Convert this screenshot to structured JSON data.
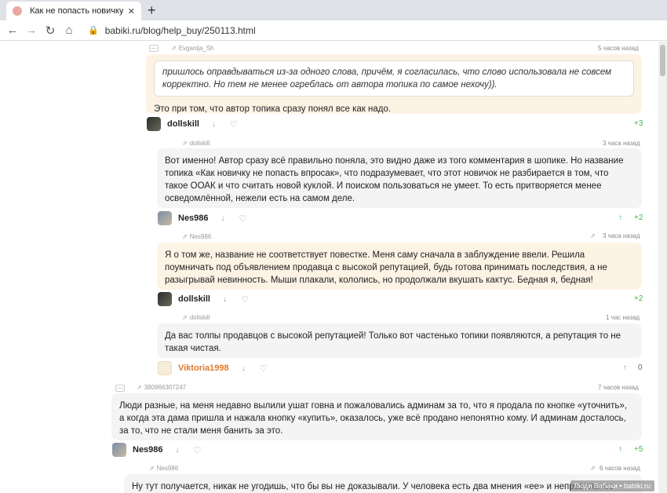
{
  "browser": {
    "tab_title": "Как не попасть новичку впроса",
    "tab_close": "✕",
    "new_tab": "+",
    "url": "babiki.ru/blog/help_buy/250113.html"
  },
  "comments": {
    "c1": {
      "reply_to": "Evganija_Sh",
      "time": "5 часов назад",
      "quote": "пришлось оправдываться из-за одного слова, причём, я согласилась, что слово использовала не совсем корректно. Но тем не менее огреблась от автора топика по самое нехочу)).",
      "text": "Это при том, что автор топика сразу понял все как надо."
    },
    "u1": {
      "name": "dollskill",
      "score": "+3"
    },
    "c2": {
      "reply_to": "dollskill",
      "time": "3 часа назад",
      "text": "Вот именно! Автор сразу всё правильно поняла, это видно даже из того комментария в шопике. Но название топика «Как новичку не попасть впросак», что подразумевает, что этот новичок не разбирается в том, что такое ООАК и что считать новой куклой. И поиском пользоваться не умеет. То есть притворяется менее осведомлённой, нежели есть на самом деле."
    },
    "u2": {
      "name": "Nes986",
      "score": "+2"
    },
    "c3": {
      "reply_to": "Nes986",
      "time": "3 часа назад",
      "text": "Я о том же, название не соответствует повестке. Меня саму сначала в заблуждение ввели. Решила поумничать под объявлением продавца с высокой репутацией, будь готова принимать последствия, а не разыгрывай невинность. Мыши плакали, кололись, но продолжали вкушать кактус. Бедная я, бедная!"
    },
    "u3": {
      "name": "dollskill",
      "score": "+2"
    },
    "c4": {
      "reply_to": "dollskill",
      "time": "1 час назад",
      "text": "Да вас толпы продавцов с высокой репутацией! Только вот частенько топики появляются, а репутация то не такая чистая."
    },
    "u4": {
      "name": "Viktoria1998",
      "score": "0"
    },
    "c5": {
      "reply_to": "380966307247",
      "time": "7 часов назад",
      "text": "Люди разные, на меня недавно вылили ушат говна и пожаловались админам за то, что я продала по кнопке «уточнить», а когда эта дама пришла и нажала кнопку «купить», оказалось, уже всё продано непонятно кому. И админам досталось, за то, что не стали меня банить за это."
    },
    "u5": {
      "name": "Nes986",
      "score": "+5"
    },
    "c6": {
      "reply_to": "Nes986",
      "time": "6 часов назад",
      "text": "Ну тут получается, никак не угодишь, что бы вы не доказывали. У человека есть два мнения «ее» и неправильное"
    }
  },
  "icons": {
    "reply": "⇗",
    "down": "↓",
    "heart": "♡",
    "up": "↑",
    "minus": "—",
    "back": "←",
    "forward": "→",
    "reload": "↻",
    "home": "⌂",
    "lock": "🔒"
  },
  "watermark": "Люди Бабики • babiki.ru"
}
